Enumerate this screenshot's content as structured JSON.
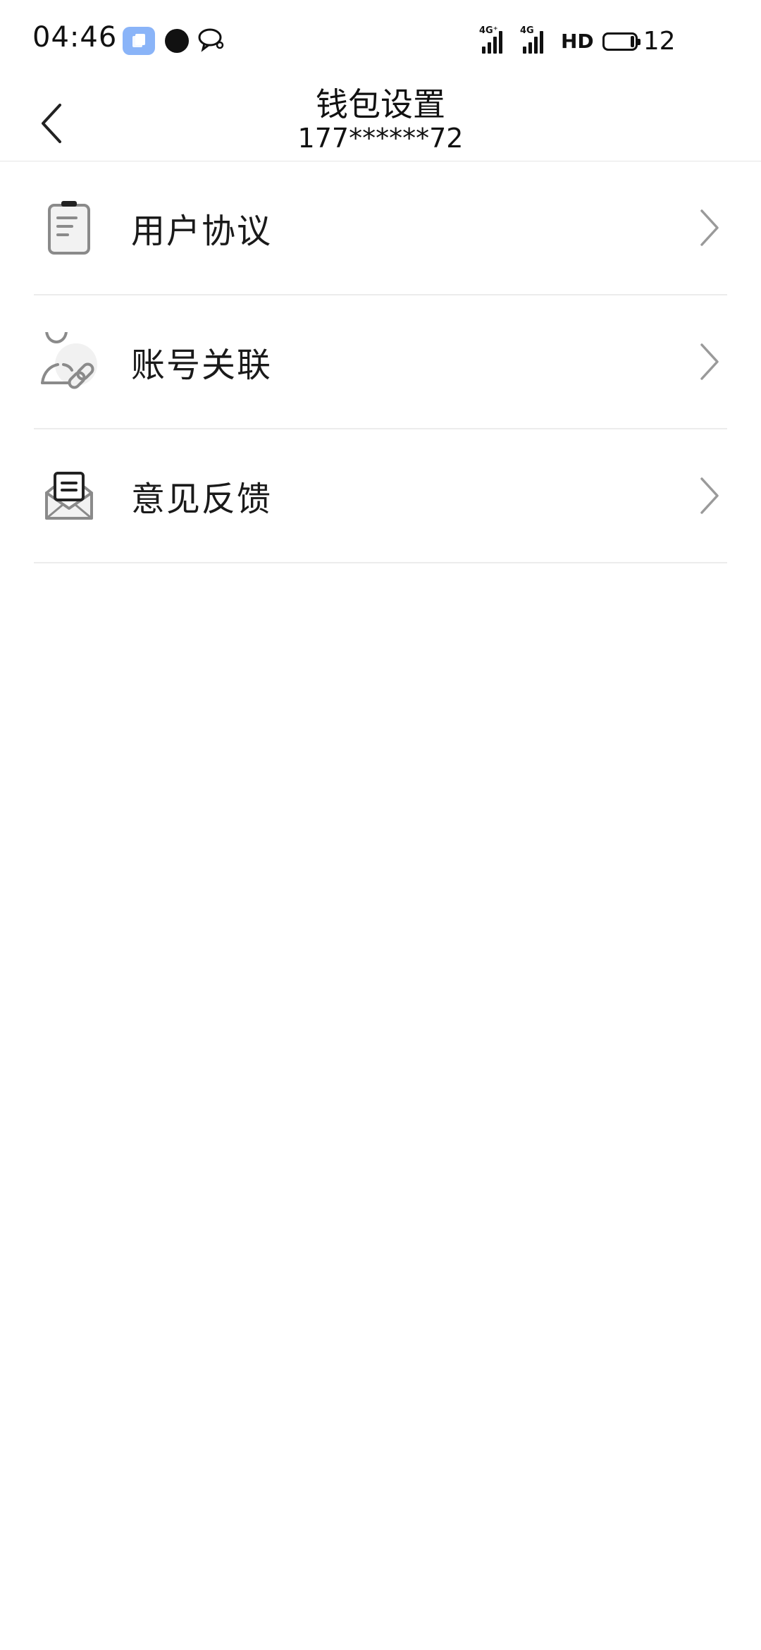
{
  "status_bar": {
    "time": "04:46",
    "network_1": "4G⁺",
    "network_2": "4G",
    "hd_label": "HD",
    "battery_level": "12",
    "icons": [
      "app-badge-icon",
      "notification-dot-icon",
      "chat-bubble-icon",
      "signal-icon",
      "signal-icon",
      "battery-icon"
    ]
  },
  "header": {
    "title": "钱包设置",
    "subtitle": "177******72"
  },
  "menu": {
    "items": [
      {
        "label": "用户协议",
        "icon": "clipboard-document-icon"
      },
      {
        "label": "账号关联",
        "icon": "user-link-icon"
      },
      {
        "label": "意见反馈",
        "icon": "envelope-open-icon"
      }
    ]
  },
  "colors": {
    "icon_gray": "#8a8a8a",
    "chevron_gray": "#9a9a9a",
    "divider": "#ececec",
    "badge_blue": "#8ab4f8"
  }
}
